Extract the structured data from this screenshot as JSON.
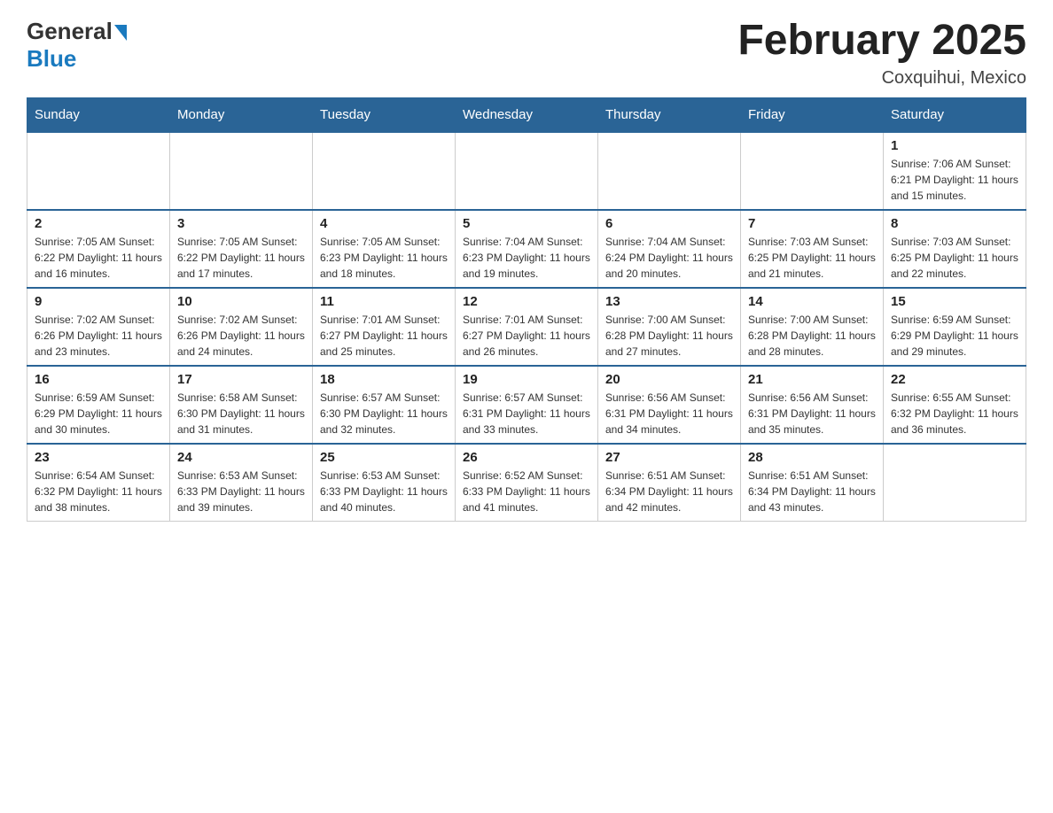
{
  "header": {
    "logo_general": "General",
    "logo_blue": "Blue",
    "month_title": "February 2025",
    "location": "Coxquihui, Mexico"
  },
  "days_of_week": [
    "Sunday",
    "Monday",
    "Tuesday",
    "Wednesday",
    "Thursday",
    "Friday",
    "Saturday"
  ],
  "weeks": [
    [
      {
        "day": "",
        "info": ""
      },
      {
        "day": "",
        "info": ""
      },
      {
        "day": "",
        "info": ""
      },
      {
        "day": "",
        "info": ""
      },
      {
        "day": "",
        "info": ""
      },
      {
        "day": "",
        "info": ""
      },
      {
        "day": "1",
        "info": "Sunrise: 7:06 AM\nSunset: 6:21 PM\nDaylight: 11 hours and 15 minutes."
      }
    ],
    [
      {
        "day": "2",
        "info": "Sunrise: 7:05 AM\nSunset: 6:22 PM\nDaylight: 11 hours and 16 minutes."
      },
      {
        "day": "3",
        "info": "Sunrise: 7:05 AM\nSunset: 6:22 PM\nDaylight: 11 hours and 17 minutes."
      },
      {
        "day": "4",
        "info": "Sunrise: 7:05 AM\nSunset: 6:23 PM\nDaylight: 11 hours and 18 minutes."
      },
      {
        "day": "5",
        "info": "Sunrise: 7:04 AM\nSunset: 6:23 PM\nDaylight: 11 hours and 19 minutes."
      },
      {
        "day": "6",
        "info": "Sunrise: 7:04 AM\nSunset: 6:24 PM\nDaylight: 11 hours and 20 minutes."
      },
      {
        "day": "7",
        "info": "Sunrise: 7:03 AM\nSunset: 6:25 PM\nDaylight: 11 hours and 21 minutes."
      },
      {
        "day": "8",
        "info": "Sunrise: 7:03 AM\nSunset: 6:25 PM\nDaylight: 11 hours and 22 minutes."
      }
    ],
    [
      {
        "day": "9",
        "info": "Sunrise: 7:02 AM\nSunset: 6:26 PM\nDaylight: 11 hours and 23 minutes."
      },
      {
        "day": "10",
        "info": "Sunrise: 7:02 AM\nSunset: 6:26 PM\nDaylight: 11 hours and 24 minutes."
      },
      {
        "day": "11",
        "info": "Sunrise: 7:01 AM\nSunset: 6:27 PM\nDaylight: 11 hours and 25 minutes."
      },
      {
        "day": "12",
        "info": "Sunrise: 7:01 AM\nSunset: 6:27 PM\nDaylight: 11 hours and 26 minutes."
      },
      {
        "day": "13",
        "info": "Sunrise: 7:00 AM\nSunset: 6:28 PM\nDaylight: 11 hours and 27 minutes."
      },
      {
        "day": "14",
        "info": "Sunrise: 7:00 AM\nSunset: 6:28 PM\nDaylight: 11 hours and 28 minutes."
      },
      {
        "day": "15",
        "info": "Sunrise: 6:59 AM\nSunset: 6:29 PM\nDaylight: 11 hours and 29 minutes."
      }
    ],
    [
      {
        "day": "16",
        "info": "Sunrise: 6:59 AM\nSunset: 6:29 PM\nDaylight: 11 hours and 30 minutes."
      },
      {
        "day": "17",
        "info": "Sunrise: 6:58 AM\nSunset: 6:30 PM\nDaylight: 11 hours and 31 minutes."
      },
      {
        "day": "18",
        "info": "Sunrise: 6:57 AM\nSunset: 6:30 PM\nDaylight: 11 hours and 32 minutes."
      },
      {
        "day": "19",
        "info": "Sunrise: 6:57 AM\nSunset: 6:31 PM\nDaylight: 11 hours and 33 minutes."
      },
      {
        "day": "20",
        "info": "Sunrise: 6:56 AM\nSunset: 6:31 PM\nDaylight: 11 hours and 34 minutes."
      },
      {
        "day": "21",
        "info": "Sunrise: 6:56 AM\nSunset: 6:31 PM\nDaylight: 11 hours and 35 minutes."
      },
      {
        "day": "22",
        "info": "Sunrise: 6:55 AM\nSunset: 6:32 PM\nDaylight: 11 hours and 36 minutes."
      }
    ],
    [
      {
        "day": "23",
        "info": "Sunrise: 6:54 AM\nSunset: 6:32 PM\nDaylight: 11 hours and 38 minutes."
      },
      {
        "day": "24",
        "info": "Sunrise: 6:53 AM\nSunset: 6:33 PM\nDaylight: 11 hours and 39 minutes."
      },
      {
        "day": "25",
        "info": "Sunrise: 6:53 AM\nSunset: 6:33 PM\nDaylight: 11 hours and 40 minutes."
      },
      {
        "day": "26",
        "info": "Sunrise: 6:52 AM\nSunset: 6:33 PM\nDaylight: 11 hours and 41 minutes."
      },
      {
        "day": "27",
        "info": "Sunrise: 6:51 AM\nSunset: 6:34 PM\nDaylight: 11 hours and 42 minutes."
      },
      {
        "day": "28",
        "info": "Sunrise: 6:51 AM\nSunset: 6:34 PM\nDaylight: 11 hours and 43 minutes."
      },
      {
        "day": "",
        "info": ""
      }
    ]
  ]
}
